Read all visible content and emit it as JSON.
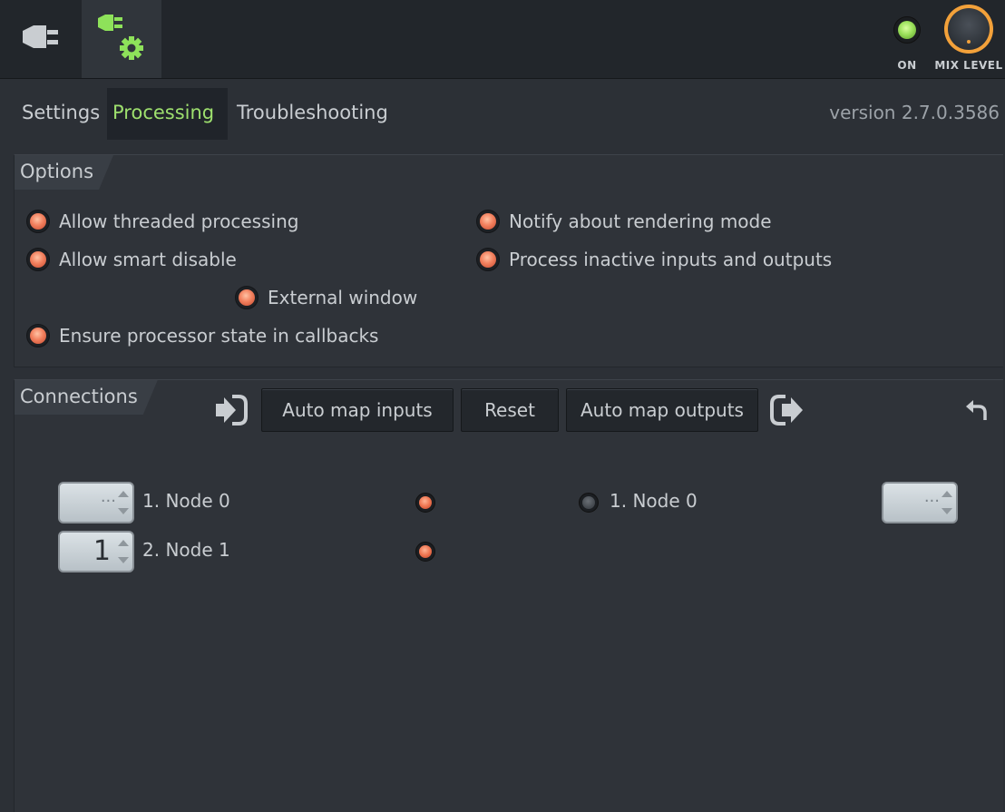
{
  "toolbar": {
    "plug_icon": "plug-icon",
    "wrapper_icon": "plug-gear-icon",
    "on_label": "ON",
    "mix_label": "MIX LEVEL",
    "on_color": "#9ae05a",
    "knob_color": "#f3a13a"
  },
  "tabs": [
    {
      "label": "Settings",
      "active": false
    },
    {
      "label": "Processing",
      "active": true
    },
    {
      "label": "Troubleshooting",
      "active": false
    }
  ],
  "version": "version 2.7.0.3586",
  "options": {
    "title": "Options",
    "items": [
      {
        "label": "Allow threaded processing",
        "checked": true
      },
      {
        "label": "Notify about rendering mode",
        "checked": true
      },
      {
        "label": "Allow smart disable",
        "checked": true
      },
      {
        "label": "Process inactive inputs and outputs",
        "checked": true
      },
      {
        "label": "External window",
        "checked": true
      },
      {
        "label": "Ensure processor state in callbacks",
        "checked": true
      }
    ]
  },
  "connections": {
    "title": "Connections",
    "auto_map_inputs": "Auto map inputs",
    "reset": "Reset",
    "auto_map_outputs": "Auto map outputs",
    "inputs": [
      {
        "label": "1. Node 0",
        "value": "···",
        "active": true
      },
      {
        "label": "2. Node 1",
        "value": "1",
        "active": true
      }
    ],
    "outputs": [
      {
        "label": "1. Node 0",
        "value": "···",
        "active": false
      }
    ]
  }
}
